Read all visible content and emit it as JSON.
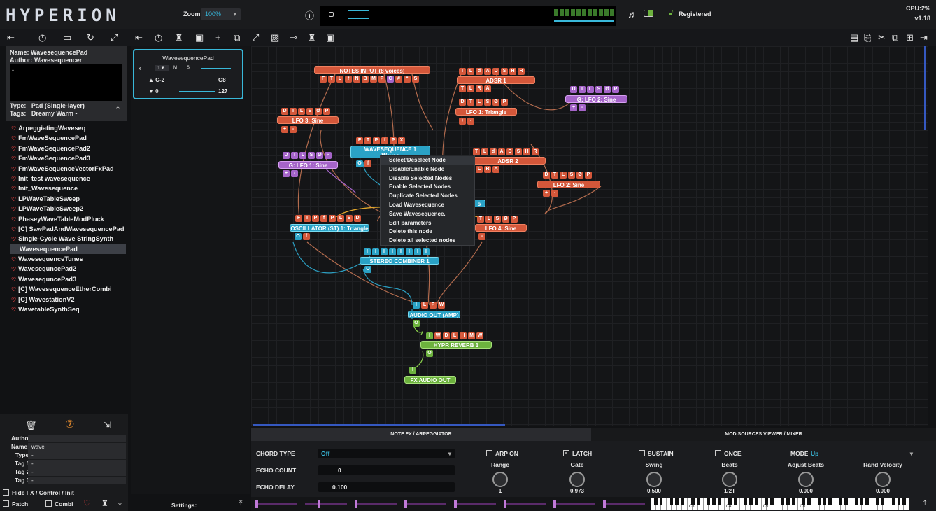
{
  "app": {
    "logo": "HYPERION",
    "zoom_label": "Zoom:",
    "zoom_value": "100%",
    "status": "Registered",
    "cpu": "CPU:2%",
    "version": "v1.18",
    "accent": "#39b8d9"
  },
  "patch_info": {
    "name_label": "Name:",
    "name": "WavesequencePad",
    "author_label": "Author:",
    "author": "Wavesequencer",
    "desc": "-",
    "type_label": "Type:",
    "type": "Pad (Single-layer)",
    "tags_label": "Tags:",
    "tags": "Dreamy Warm -"
  },
  "patches": [
    "ArpeggiatingWaveseq",
    "FmWaveSequencePad",
    "FmWaveSequencePad2",
    "FmWaveSequencePad3",
    "FmWaveSequenceVectorFxPad",
    "Init_test wavesequence",
    "Init_Wavesequence",
    "LPWaveTableSweep",
    "LPWaveTableSweep2",
    "PhaseyWaveTableModPluck",
    "[C] SawPadAndWavesequencePad",
    "Single-Cycle Wave StringSynth",
    "WavesequencePad",
    "WavesequenceTunes",
    "WavesequncePad2",
    "WavesequncePad3",
    "[C] WavesequenceEtherCombi",
    "[C] WavestationV2",
    "WavetableSynthSeq"
  ],
  "selected_patch": "WavesequencePad",
  "filter": {
    "author_label": "Author:",
    "author": "",
    "name_label": "Name:",
    "name": "wave",
    "type_label": "Type:",
    "type": "-",
    "tag1_label": "Tag 1:",
    "tag1": "-",
    "tag2_label": "Tag 2:",
    "tag2": "-",
    "tag3_label": "Tag 3:",
    "tag3": "-",
    "hide_label": "Hide FX / Control / Init",
    "patch_label": "Patch",
    "combi_label": "Combi"
  },
  "settings_label": "Settings:",
  "seq_card": {
    "title": "WavesequencePad",
    "x": "x",
    "one": "1",
    "key_low": "C-2",
    "key_high": "G8",
    "vel_low": "0",
    "vel_high": "127",
    "m": "M",
    "s": "S"
  },
  "nodes": {
    "notes_input": "NOTES INPUT  (8 voices)",
    "adsr1": "ADSR 1",
    "lfo1": "LFO 1: Triangle",
    "lfo3": "LFO 3: Sine",
    "glfo2": "G: LFO 2: Sine",
    "wavesequence": "WAVESEQUENCE 1",
    "waves_short": "Waves",
    "glfo1": "G: LFO 1: Sine",
    "adsr2": "ADSR 2",
    "lfo2": "LFO 2: Sine",
    "osc": "OSCILLATOR (ST) 1: Triangle",
    "lfo4": "LFO 4: Sine",
    "stereo": "STEREO COMBINER 1",
    "audio_out": "AUDIO OUT (AMP)",
    "reverb": "HYPR REVERB 1",
    "fx_out": "FX AUDIO OUT"
  },
  "context_menu": [
    "Select/Deselect Node",
    "Disable/Enable Node",
    "Disable Selected Nodes",
    "Enable Selected Nodes",
    "Duplicate Selected Nodes",
    "Load Wavesequence",
    "Save Wavesequence.",
    "Edit parameters",
    "Delete this node",
    "Delete all selected nodes"
  ],
  "bottom": {
    "tab1": "NOTE FX / ARPEGGIATOR",
    "tab2": "MOD SOURCES VIEWER / MIXER",
    "chord_label": "CHORD TYPE",
    "chord_value": "Off",
    "echo_count_label": "ECHO COUNT",
    "echo_count": "0",
    "echo_delay_label": "ECHO DELAY",
    "echo_delay": "0.100",
    "arp_on": "ARP ON",
    "latch": "LATCH",
    "sustain": "SUSTAIN",
    "once": "ONCE",
    "mode_label": "MODE",
    "mode_value": "Up",
    "knobs": [
      {
        "label": "Range",
        "value": "1"
      },
      {
        "label": "Gate",
        "value": "0.973"
      },
      {
        "label": "Swing",
        "value": "0.500"
      },
      {
        "label": "Beats",
        "value": "1/2T"
      },
      {
        "label": "Adjust Beats",
        "value": "0.000"
      },
      {
        "label": "Rand Velocity",
        "value": "0.000"
      }
    ],
    "key_labels": [
      "C3",
      "C4",
      "C5",
      "C6"
    ]
  }
}
